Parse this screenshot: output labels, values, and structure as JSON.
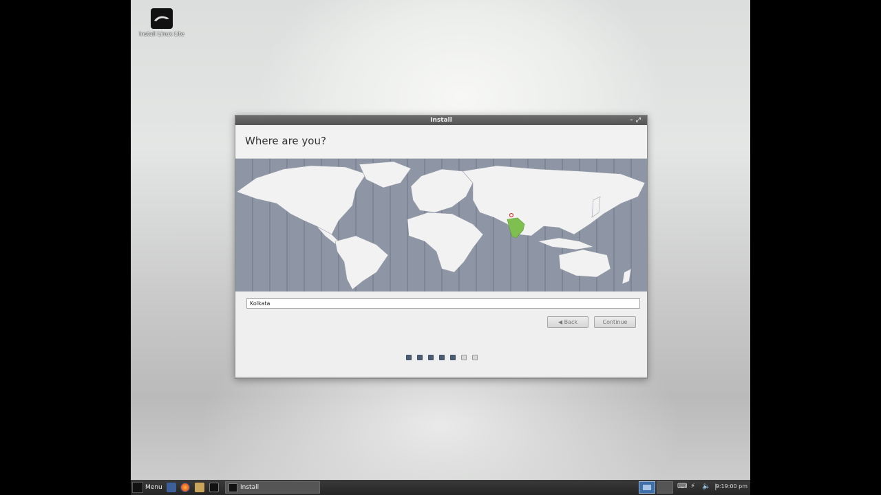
{
  "desktop": {
    "icon_label": "Install Linux Lite"
  },
  "window": {
    "title": "Install",
    "controls": "– ↗",
    "heading": "Where are you?",
    "timezone_value": "Kolkata",
    "back_label": "Back",
    "continue_label": "Continue",
    "progress_total": 7,
    "progress_current": 5
  },
  "taskbar": {
    "menu_label": "Menu",
    "task_label": "Install",
    "clock": "9:19:00 pm"
  },
  "colors": {
    "ocean": "#8e96a6",
    "land": "#f2f2f2",
    "selected_region": "#7fbf4f",
    "pin": "#d9342b"
  }
}
